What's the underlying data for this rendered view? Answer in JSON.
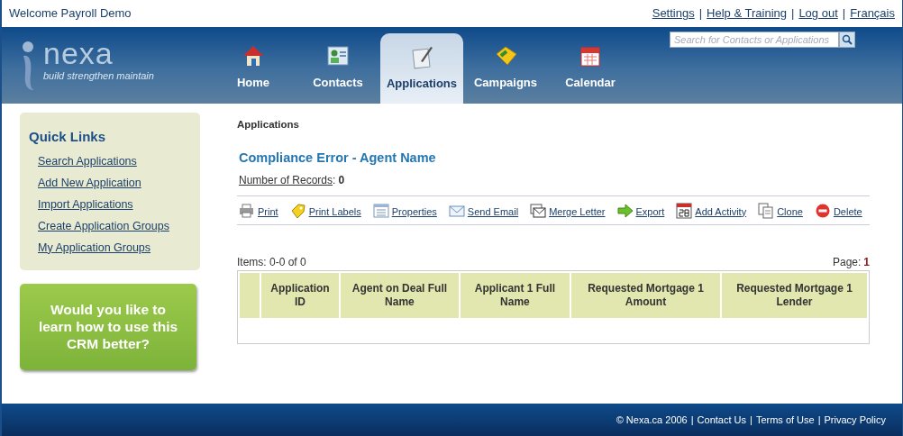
{
  "top_bar": {
    "welcome": "Welcome Payroll Demo",
    "separator": "|",
    "links": [
      "Settings",
      "Help & Training",
      "Log out",
      "Français"
    ]
  },
  "header": {
    "logo_name": "nexa",
    "logo_tagline": "build strengthen maintain",
    "search": {
      "placeholder": "Search for Contacts or Applications"
    },
    "tabs": [
      {
        "label": "Home",
        "kind": "house",
        "selected": false
      },
      {
        "label": "Contacts",
        "kind": "contacts",
        "selected": false
      },
      {
        "label": "Applications",
        "kind": "pen",
        "selected": true
      },
      {
        "label": "Campaigns",
        "kind": "tag",
        "selected": false
      },
      {
        "label": "Calendar",
        "kind": "calendar",
        "selected": false
      }
    ]
  },
  "sidebar": {
    "title": "Quick Links",
    "links": [
      "Search Applications",
      "Add New Application",
      "Import Applications",
      "Create Application Groups",
      "My Application Groups"
    ],
    "promo": "Would you like to learn how to use this CRM better?"
  },
  "main": {
    "breadcrumb": "Applications",
    "title": "Compliance Error - Agent Name",
    "records_label": "Number of Records",
    "records_colon": ":",
    "records_value": "0",
    "actions": [
      {
        "label": "Print",
        "kind": "printer"
      },
      {
        "label": "Print Labels",
        "kind": "label"
      },
      {
        "label": "Properties",
        "kind": "list"
      },
      {
        "label": "Send Email",
        "kind": "envelope"
      },
      {
        "label": "Merge Letter",
        "kind": "letters"
      },
      {
        "label": "Export",
        "kind": "arrow"
      },
      {
        "label": "Add Activity",
        "kind": "calendar28"
      },
      {
        "label": "Clone",
        "kind": "copy"
      },
      {
        "label": "Delete",
        "kind": "minus"
      }
    ],
    "items": "Items: 0-0 of 0",
    "page_label": "Page:",
    "page_value": "1",
    "table": {
      "columns": [
        "Application ID",
        "Agent on Deal Full Name",
        "Applicant 1 Full Name",
        "Requested Mortgage 1 Amount",
        "Requested Mortgage 1 Lender"
      ]
    }
  },
  "footer": {
    "copyright": "© Nexa.ca 2006",
    "separator": "|",
    "links": [
      "Contact Us",
      "Terms of Use",
      "Privacy Policy"
    ]
  }
}
